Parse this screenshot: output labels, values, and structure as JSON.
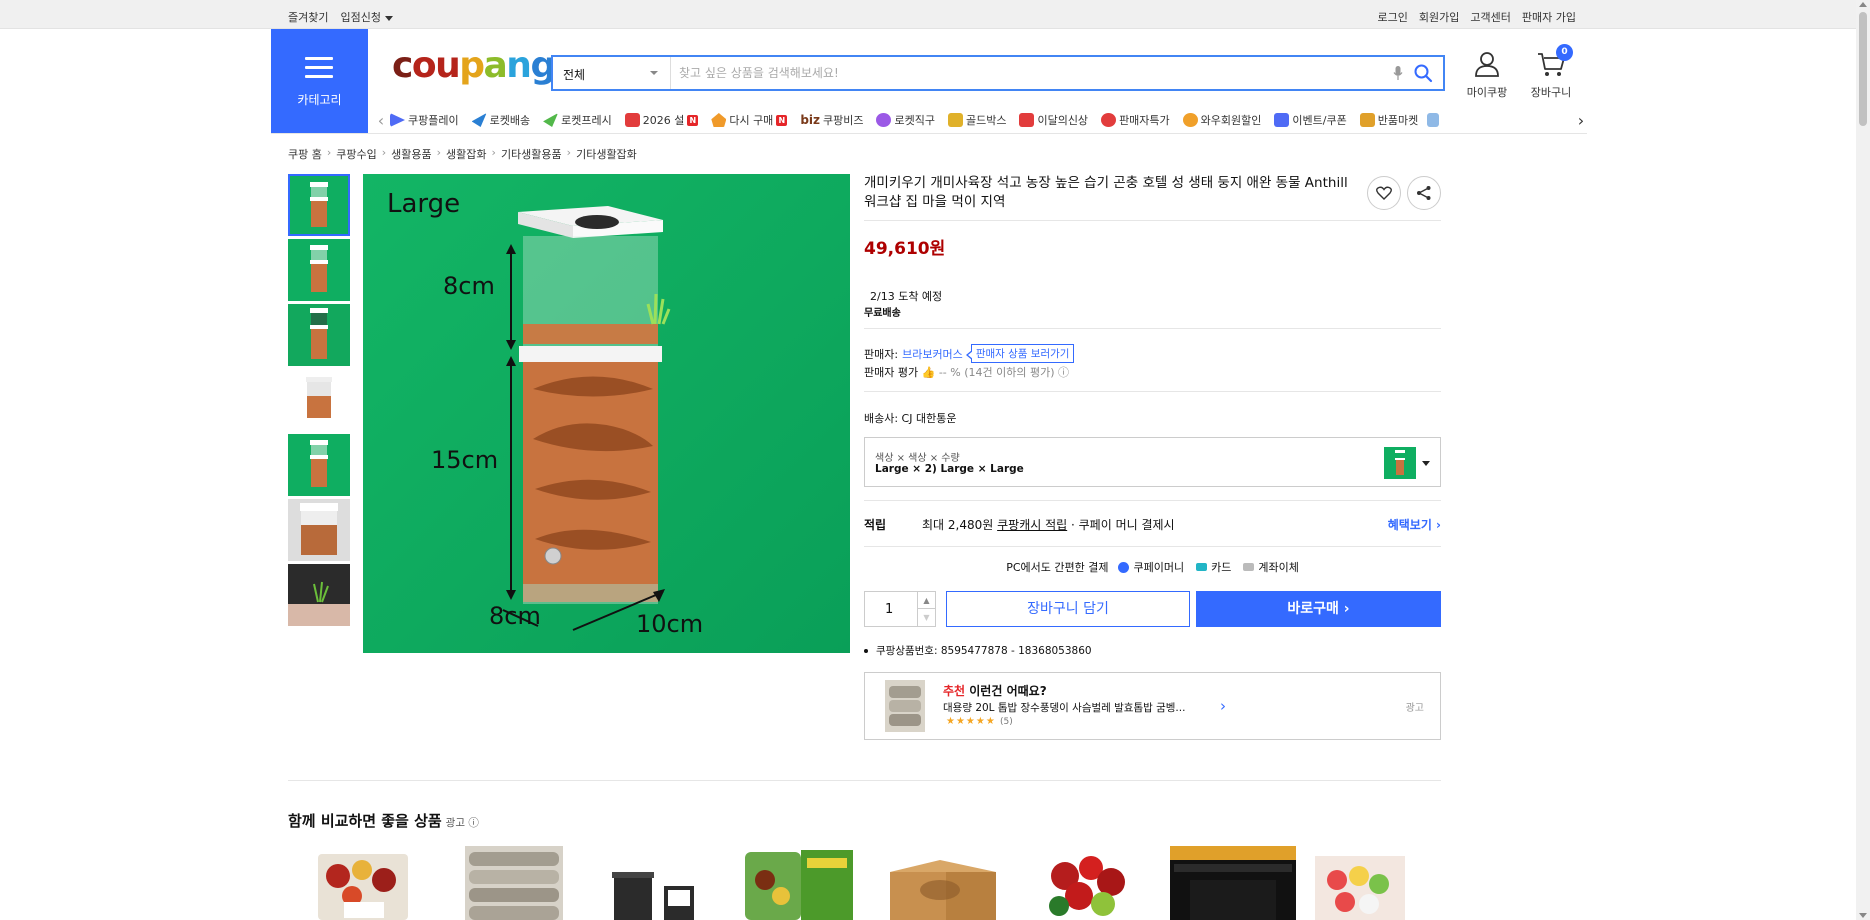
{
  "topbar": {
    "left": [
      "즐겨찾기",
      "입점신청"
    ],
    "right": [
      "로그인",
      "회원가입",
      "고객센터",
      "판매자 가입"
    ]
  },
  "header": {
    "category_label": "카테고리",
    "logo": [
      "c",
      "ou",
      "p",
      "a",
      "n",
      "g"
    ],
    "search": {
      "category": "전체",
      "placeholder": "찾고 싶은 상품을 검색해보세요!"
    },
    "mycoupang": "마이쿠팡",
    "cart": "장바구니",
    "cart_count": "0"
  },
  "nav": [
    {
      "label": "쿠팡플레이",
      "color": "#4f6bf5",
      "badge": ""
    },
    {
      "label": "로켓배송",
      "color": "#2a7fd3",
      "badge": ""
    },
    {
      "label": "로켓프레시",
      "color": "#52b84a",
      "badge": ""
    },
    {
      "label": "2026 설",
      "color": "#e23c3c",
      "badge": "N"
    },
    {
      "label": "다시 구매",
      "color": "#f09a2a",
      "badge": "N"
    },
    {
      "label": "쿠팡비즈",
      "color": "#7a3a1a",
      "badge": "",
      "prefix": "biz"
    },
    {
      "label": "로켓직구",
      "color": "#9b59e6",
      "badge": ""
    },
    {
      "label": "골드박스",
      "color": "#e0b12a",
      "badge": ""
    },
    {
      "label": "이달의신상",
      "color": "#e23c3c",
      "badge": ""
    },
    {
      "label": "판매자특가",
      "color": "#e23c3c",
      "badge": ""
    },
    {
      "label": "와우회원할인",
      "color": "#f0a02a",
      "badge": ""
    },
    {
      "label": "이벤트/쿠폰",
      "color": "#4f6bf5",
      "badge": ""
    },
    {
      "label": "반품마켓",
      "color": "#e0a02a",
      "badge": ""
    }
  ],
  "breadcrumb": [
    "쿠팡 홈",
    "쿠팡수입",
    "생활용품",
    "생활잡화",
    "기타생활용품",
    "기타생활잡화"
  ],
  "image_labels": {
    "size": "Large",
    "h1": "8cm",
    "h2": "15cm",
    "w1": "8cm",
    "w2": "10cm"
  },
  "product": {
    "title": "개미키우기 개미사육장 석고 농장 높은 습기 곤충 호텔 성 생태 둥지 애완 동물 Anthill 워크샵 집 마을 먹이 지역",
    "price": "49,610원",
    "arrival": "2/13 도착 예정",
    "shipping": "무료배송",
    "seller_label": "판매자:",
    "seller_name": "브라보커머스",
    "seller_button": "판매자 상품 보러가기",
    "rating_label": "판매자 평가",
    "rating_value": "-- %",
    "rating_note": "(14건 이하의 평가)",
    "carrier": "배송사:  CJ 대한통운",
    "option_title": "색상 × 색상 × 수량",
    "option_value": "Large × 2) Large × Large",
    "reward_label": "적립",
    "reward_text_1": "최대 2,480원",
    "reward_text_2": "쿠팡캐시 적립",
    "reward_text_3": "· 쿠페이 머니 결제시",
    "reward_more": "혜택보기",
    "pay_title": "PC에서도 간편한 결제",
    "pay_methods": [
      "쿠페이머니",
      "카드",
      "계좌이체"
    ],
    "pay_colors": [
      "#346aff",
      "#22b5c6",
      "#bbbbbb"
    ],
    "quantity": "1",
    "cart_button": "장바구니 담기",
    "buy_button": "바로구매",
    "product_id": "쿠팡상품번호: 8595477878 - 18368053860"
  },
  "recommend": {
    "title_red": "추천",
    "title_rest": " 이런건 어때요?",
    "item": "대용량 20L 톱밥 장수풍뎅이 사슴벌레 발효톱밥 굼벵...",
    "stars": "★★★★★",
    "count": "(5)",
    "ad": "광고"
  },
  "compare": {
    "title": "함께 비교하면 좋을 상품",
    "ad": "광고"
  }
}
